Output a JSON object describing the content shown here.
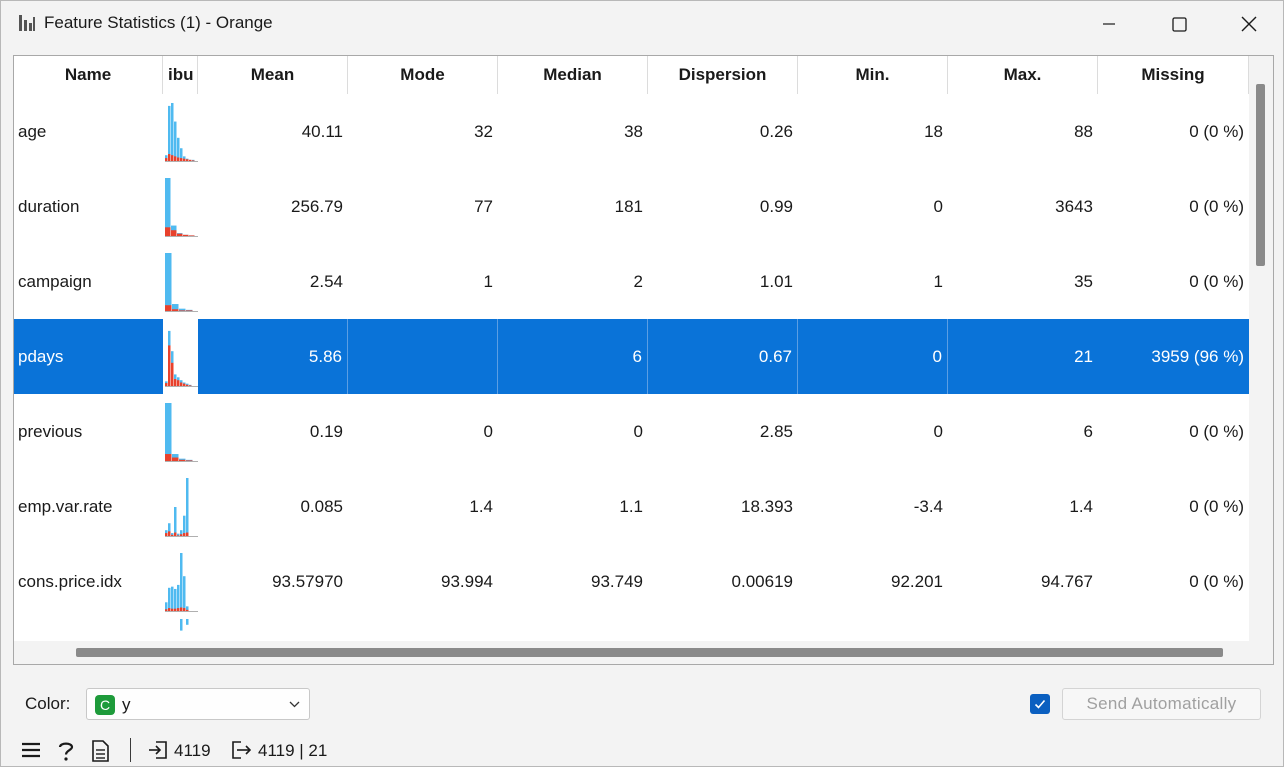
{
  "window": {
    "title": "Feature Statistics (1) - Orange"
  },
  "table": {
    "columns": [
      "Name",
      "ibu",
      "Mean",
      "Mode",
      "Median",
      "Dispersion",
      "Min.",
      "Max.",
      "Missing"
    ],
    "rows": [
      {
        "name": "age",
        "mean": "40.11",
        "mode": "32",
        "median": "38",
        "dispersion": "0.26",
        "min": "18",
        "max": "88",
        "missing": "0 (0 %)",
        "hist": [
          {
            "b": 0.1,
            "r": 0.05
          },
          {
            "b": 0.95,
            "r": 0.12
          },
          {
            "b": 1.0,
            "r": 0.1
          },
          {
            "b": 0.68,
            "r": 0.08
          },
          {
            "b": 0.4,
            "r": 0.06
          },
          {
            "b": 0.22,
            "r": 0.05
          },
          {
            "b": 0.08,
            "r": 0.04
          },
          {
            "b": 0.04,
            "r": 0.03
          },
          {
            "b": 0.02,
            "r": 0.02
          },
          {
            "b": 0.02,
            "r": 0.01
          }
        ]
      },
      {
        "name": "duration",
        "mean": "256.79",
        "mode": "77",
        "median": "181",
        "dispersion": "0.99",
        "min": "0",
        "max": "3643",
        "missing": "0 (0 %)",
        "hist": [
          {
            "b": 1.0,
            "r": 0.15
          },
          {
            "b": 0.18,
            "r": 0.1
          },
          {
            "b": 0.05,
            "r": 0.04
          },
          {
            "b": 0.02,
            "r": 0.02
          },
          {
            "b": 0.01,
            "r": 0.01
          }
        ]
      },
      {
        "name": "campaign",
        "mean": "2.54",
        "mode": "1",
        "median": "2",
        "dispersion": "1.01",
        "min": "1",
        "max": "35",
        "missing": "0 (0 %)",
        "hist": [
          {
            "b": 1.0,
            "r": 0.1
          },
          {
            "b": 0.12,
            "r": 0.03
          },
          {
            "b": 0.04,
            "r": 0.01
          },
          {
            "b": 0.02,
            "r": 0.01
          }
        ]
      },
      {
        "name": "pdays",
        "mean": "5.86",
        "mode": "",
        "median": "6",
        "dispersion": "0.67",
        "min": "0",
        "max": "21",
        "missing": "3959 (96 %)",
        "selected": true,
        "hist": [
          {
            "b": 0.08,
            "r": 0.05
          },
          {
            "b": 0.95,
            "r": 0.7
          },
          {
            "b": 0.6,
            "r": 0.4
          },
          {
            "b": 0.2,
            "r": 0.12
          },
          {
            "b": 0.15,
            "r": 0.1
          },
          {
            "b": 0.1,
            "r": 0.06
          },
          {
            "b": 0.06,
            "r": 0.04
          },
          {
            "b": 0.04,
            "r": 0.02
          },
          {
            "b": 0.02,
            "r": 0.01
          }
        ]
      },
      {
        "name": "previous",
        "mean": "0.19",
        "mode": "0",
        "median": "0",
        "dispersion": "2.85",
        "min": "0",
        "max": "6",
        "missing": "0 (0 %)",
        "hist": [
          {
            "b": 1.0,
            "r": 0.12
          },
          {
            "b": 0.12,
            "r": 0.06
          },
          {
            "b": 0.04,
            "r": 0.02
          },
          {
            "b": 0.02,
            "r": 0.01
          }
        ]
      },
      {
        "name": "emp.var.rate",
        "mean": "0.085",
        "mode": "1.4",
        "median": "1.1",
        "dispersion": "18.393",
        "min": "-3.4",
        "max": "1.4",
        "missing": "0 (0 %)",
        "hist": [
          {
            "b": 0.1,
            "r": 0.05
          },
          {
            "b": 0.22,
            "r": 0.08
          },
          {
            "b": 0.05,
            "r": 0.02
          },
          {
            "b": 0.5,
            "r": 0.06
          },
          {
            "b": 0.04,
            "r": 0.01
          },
          {
            "b": 0.1,
            "r": 0.03
          },
          {
            "b": 0.35,
            "r": 0.05
          },
          {
            "b": 1.0,
            "r": 0.06
          }
        ]
      },
      {
        "name": "cons.price.idx",
        "mean": "93.57970",
        "mode": "93.994",
        "median": "93.749",
        "dispersion": "0.00619",
        "min": "92.201",
        "max": "94.767",
        "missing": "0 (0 %)",
        "hist": [
          {
            "b": 0.15,
            "r": 0.03
          },
          {
            "b": 0.4,
            "r": 0.05
          },
          {
            "b": 0.42,
            "r": 0.04
          },
          {
            "b": 0.38,
            "r": 0.04
          },
          {
            "b": 0.45,
            "r": 0.05
          },
          {
            "b": 1.0,
            "r": 0.06
          },
          {
            "b": 0.6,
            "r": 0.05
          },
          {
            "b": 0.08,
            "r": 0.02
          }
        ]
      },
      {
        "name": "",
        "mean": "",
        "mode": "",
        "median": "",
        "dispersion": "",
        "min": "",
        "max": "",
        "missing": "",
        "hist": [
          {
            "b": 0.0,
            "r": 0.0
          },
          {
            "b": 0.0,
            "r": 0.0
          },
          {
            "b": 0.0,
            "r": 0.0
          },
          {
            "b": 0.0,
            "r": 0.0
          },
          {
            "b": 0.0,
            "r": 0.0
          },
          {
            "b": 1.0,
            "r": 0.0
          },
          {
            "b": 0.0,
            "r": 0.0
          },
          {
            "b": 0.5,
            "r": 0.0
          }
        ]
      }
    ]
  },
  "controls": {
    "color_label": "Color:",
    "color_badge": "C",
    "color_value": "y",
    "send_label": "Send Automatically",
    "send_checked": true
  },
  "status": {
    "input_count": "4119",
    "output_count": "4119 | 21"
  },
  "colors": {
    "selection": "#0a73d8",
    "hist_blue": "#4fbaf0",
    "hist_red": "#e8412c",
    "badge_green": "#1e9b3b"
  },
  "icons": [
    "app-icon",
    "minimize-icon",
    "maximize-icon",
    "close-icon",
    "chevron-down-icon",
    "checkmark-icon",
    "menu-icon",
    "help-icon",
    "report-icon",
    "input-icon",
    "output-icon"
  ]
}
